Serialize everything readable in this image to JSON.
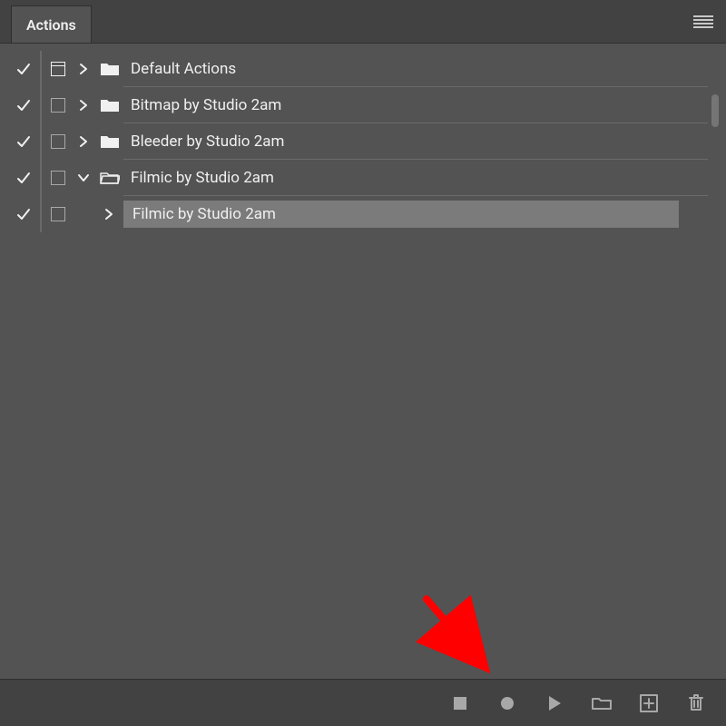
{
  "colors": {
    "accent": "#ff0000"
  },
  "tab": {
    "title": "Actions"
  },
  "groups": [
    {
      "label": "Default Actions",
      "checked": true,
      "expanded": false,
      "hasModalIndicator": true
    },
    {
      "label": "Bitmap by Studio 2am",
      "checked": true,
      "expanded": false,
      "hasModalIndicator": false
    },
    {
      "label": "Bleeder by Studio 2am",
      "checked": true,
      "expanded": false,
      "hasModalIndicator": false
    },
    {
      "label": "Filmic by Studio 2am",
      "checked": true,
      "expanded": true,
      "hasModalIndicator": false,
      "actions": [
        {
          "label": "Filmic by Studio 2am",
          "checked": true,
          "selected": true
        }
      ]
    }
  ],
  "footer": {
    "stop_label": "Stop",
    "record_label": "Record",
    "play_label": "Play",
    "folder_label": "New Set",
    "new_label": "New Action",
    "trash_label": "Delete"
  }
}
